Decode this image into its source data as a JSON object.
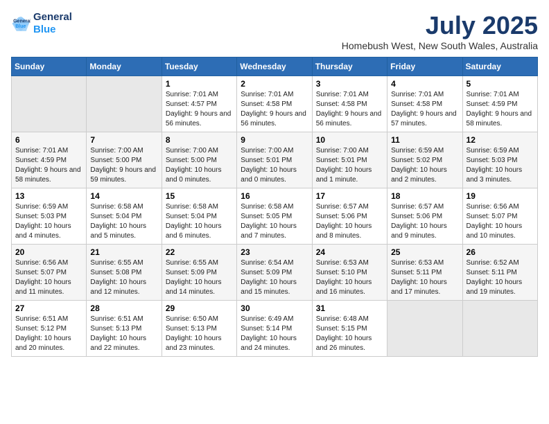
{
  "logo": {
    "line1": "General",
    "line2": "Blue"
  },
  "title": "July 2025",
  "subtitle": "Homebush West, New South Wales, Australia",
  "days_header": [
    "Sunday",
    "Monday",
    "Tuesday",
    "Wednesday",
    "Thursday",
    "Friday",
    "Saturday"
  ],
  "weeks": [
    [
      {
        "day": "",
        "info": ""
      },
      {
        "day": "",
        "info": ""
      },
      {
        "day": "1",
        "info": "Sunrise: 7:01 AM\nSunset: 4:57 PM\nDaylight: 9 hours and 56 minutes."
      },
      {
        "day": "2",
        "info": "Sunrise: 7:01 AM\nSunset: 4:58 PM\nDaylight: 9 hours and 56 minutes."
      },
      {
        "day": "3",
        "info": "Sunrise: 7:01 AM\nSunset: 4:58 PM\nDaylight: 9 hours and 56 minutes."
      },
      {
        "day": "4",
        "info": "Sunrise: 7:01 AM\nSunset: 4:58 PM\nDaylight: 9 hours and 57 minutes."
      },
      {
        "day": "5",
        "info": "Sunrise: 7:01 AM\nSunset: 4:59 PM\nDaylight: 9 hours and 58 minutes."
      }
    ],
    [
      {
        "day": "6",
        "info": "Sunrise: 7:01 AM\nSunset: 4:59 PM\nDaylight: 9 hours and 58 minutes."
      },
      {
        "day": "7",
        "info": "Sunrise: 7:00 AM\nSunset: 5:00 PM\nDaylight: 9 hours and 59 minutes."
      },
      {
        "day": "8",
        "info": "Sunrise: 7:00 AM\nSunset: 5:00 PM\nDaylight: 10 hours and 0 minutes."
      },
      {
        "day": "9",
        "info": "Sunrise: 7:00 AM\nSunset: 5:01 PM\nDaylight: 10 hours and 0 minutes."
      },
      {
        "day": "10",
        "info": "Sunrise: 7:00 AM\nSunset: 5:01 PM\nDaylight: 10 hours and 1 minute."
      },
      {
        "day": "11",
        "info": "Sunrise: 6:59 AM\nSunset: 5:02 PM\nDaylight: 10 hours and 2 minutes."
      },
      {
        "day": "12",
        "info": "Sunrise: 6:59 AM\nSunset: 5:03 PM\nDaylight: 10 hours and 3 minutes."
      }
    ],
    [
      {
        "day": "13",
        "info": "Sunrise: 6:59 AM\nSunset: 5:03 PM\nDaylight: 10 hours and 4 minutes."
      },
      {
        "day": "14",
        "info": "Sunrise: 6:58 AM\nSunset: 5:04 PM\nDaylight: 10 hours and 5 minutes."
      },
      {
        "day": "15",
        "info": "Sunrise: 6:58 AM\nSunset: 5:04 PM\nDaylight: 10 hours and 6 minutes."
      },
      {
        "day": "16",
        "info": "Sunrise: 6:58 AM\nSunset: 5:05 PM\nDaylight: 10 hours and 7 minutes."
      },
      {
        "day": "17",
        "info": "Sunrise: 6:57 AM\nSunset: 5:06 PM\nDaylight: 10 hours and 8 minutes."
      },
      {
        "day": "18",
        "info": "Sunrise: 6:57 AM\nSunset: 5:06 PM\nDaylight: 10 hours and 9 minutes."
      },
      {
        "day": "19",
        "info": "Sunrise: 6:56 AM\nSunset: 5:07 PM\nDaylight: 10 hours and 10 minutes."
      }
    ],
    [
      {
        "day": "20",
        "info": "Sunrise: 6:56 AM\nSunset: 5:07 PM\nDaylight: 10 hours and 11 minutes."
      },
      {
        "day": "21",
        "info": "Sunrise: 6:55 AM\nSunset: 5:08 PM\nDaylight: 10 hours and 12 minutes."
      },
      {
        "day": "22",
        "info": "Sunrise: 6:55 AM\nSunset: 5:09 PM\nDaylight: 10 hours and 14 minutes."
      },
      {
        "day": "23",
        "info": "Sunrise: 6:54 AM\nSunset: 5:09 PM\nDaylight: 10 hours and 15 minutes."
      },
      {
        "day": "24",
        "info": "Sunrise: 6:53 AM\nSunset: 5:10 PM\nDaylight: 10 hours and 16 minutes."
      },
      {
        "day": "25",
        "info": "Sunrise: 6:53 AM\nSunset: 5:11 PM\nDaylight: 10 hours and 17 minutes."
      },
      {
        "day": "26",
        "info": "Sunrise: 6:52 AM\nSunset: 5:11 PM\nDaylight: 10 hours and 19 minutes."
      }
    ],
    [
      {
        "day": "27",
        "info": "Sunrise: 6:51 AM\nSunset: 5:12 PM\nDaylight: 10 hours and 20 minutes."
      },
      {
        "day": "28",
        "info": "Sunrise: 6:51 AM\nSunset: 5:13 PM\nDaylight: 10 hours and 22 minutes."
      },
      {
        "day": "29",
        "info": "Sunrise: 6:50 AM\nSunset: 5:13 PM\nDaylight: 10 hours and 23 minutes."
      },
      {
        "day": "30",
        "info": "Sunrise: 6:49 AM\nSunset: 5:14 PM\nDaylight: 10 hours and 24 minutes."
      },
      {
        "day": "31",
        "info": "Sunrise: 6:48 AM\nSunset: 5:15 PM\nDaylight: 10 hours and 26 minutes."
      },
      {
        "day": "",
        "info": ""
      },
      {
        "day": "",
        "info": ""
      }
    ]
  ]
}
